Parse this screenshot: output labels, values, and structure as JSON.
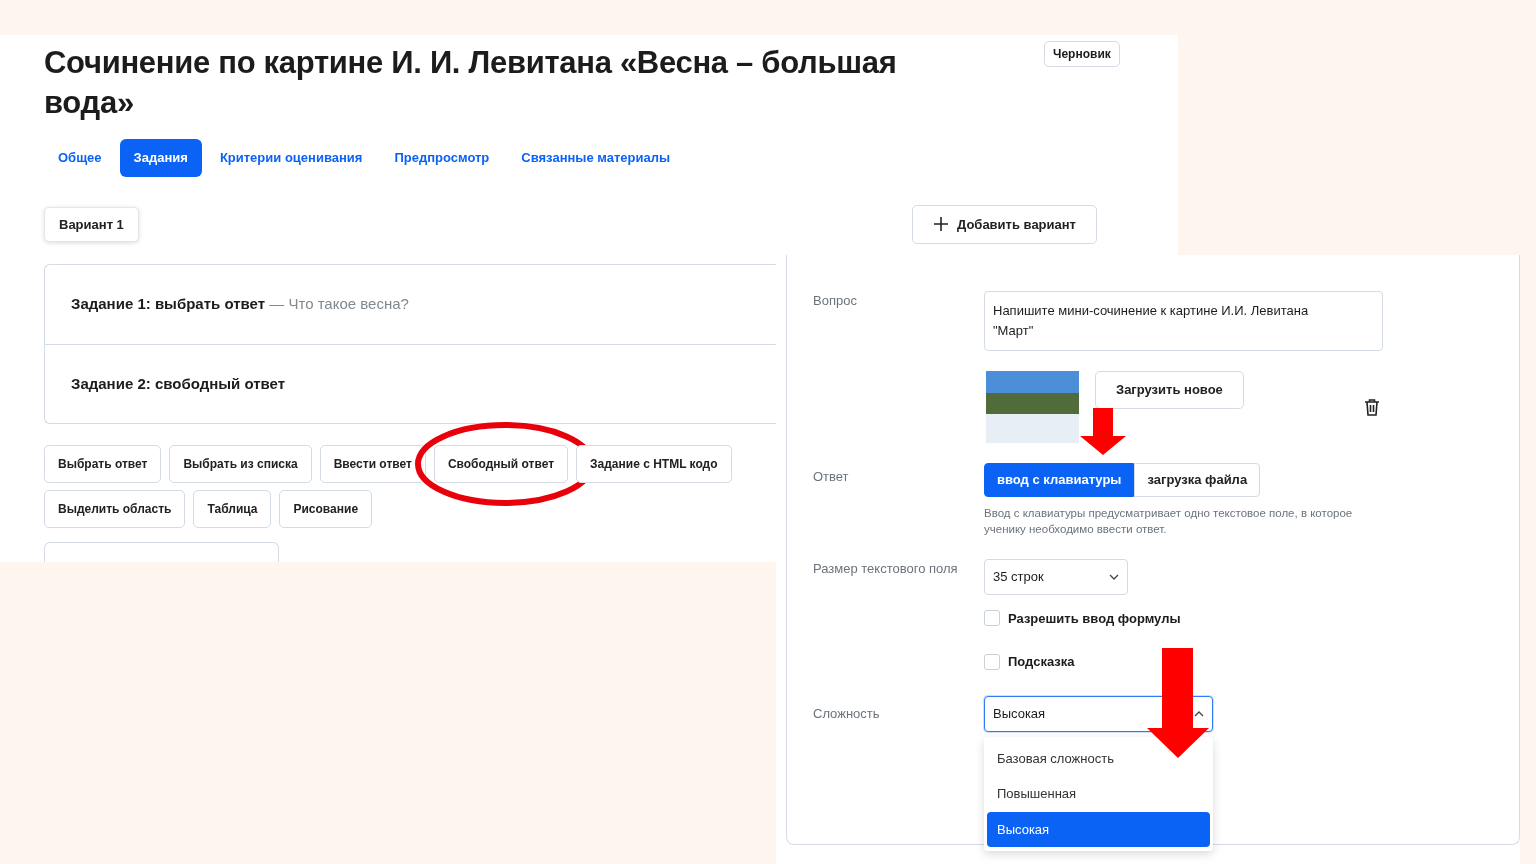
{
  "page": {
    "title": "Сочинение по картине И. И. Левитана «Весна – большая вода»",
    "status_badge": "Черновик"
  },
  "tabs": [
    {
      "label": "Общее",
      "selected": false
    },
    {
      "label": "Задания",
      "selected": true
    },
    {
      "label": "Критерии оценивания",
      "selected": false
    },
    {
      "label": "Предпросмотр",
      "selected": false
    },
    {
      "label": "Связанные материалы",
      "selected": false
    }
  ],
  "variants": [
    {
      "label": "Вариант 1"
    }
  ],
  "add_variant_button": "Добавить вариант",
  "tasks": [
    {
      "title": "Задание 1: выбрать ответ",
      "subtitle": "— Что такое весна?"
    },
    {
      "title": "Задание 2: свободный ответ"
    }
  ],
  "task_types": [
    {
      "label": "Выбрать ответ",
      "highlighted": false
    },
    {
      "label": "Выбрать из списка",
      "highlighted": false
    },
    {
      "label": "Ввести ответ",
      "highlighted": false
    },
    {
      "label": "Свободный ответ",
      "highlighted": true
    },
    {
      "label": "Задание с HTML кодо",
      "highlighted": false
    },
    {
      "label": "Выделить область",
      "highlighted": false
    },
    {
      "label": "Таблица",
      "highlighted": false
    },
    {
      "label": "Рисование",
      "highlighted": false
    }
  ],
  "editor": {
    "question_label": "Вопрос",
    "question_text": "Напишите мини-сочинение к картине И.И. Левитана \"Март\"",
    "upload_button": "Загрузить новое",
    "answer_label": "Ответ",
    "answer_modes": [
      {
        "label": "ввод с клавиатуры",
        "selected": true
      },
      {
        "label": "загрузка файла",
        "selected": false
      }
    ],
    "answer_hint": "Ввод с клавиатуры предусматривает одно текстовое поле, в которое ученику необходимо ввести ответ.",
    "size_label": "Размер текстового поля",
    "size_value": "35 строк",
    "options": [
      {
        "label": "Разрешить ввод формулы",
        "checked": false
      },
      {
        "label": "Подсказка",
        "checked": false
      }
    ],
    "difficulty_label": "Сложность",
    "difficulty_value": "Высокая",
    "difficulty_menu": {
      "expanded": true,
      "items": [
        {
          "label": "Базовая сложность",
          "selected": false
        },
        {
          "label": "Повышенная",
          "selected": false
        },
        {
          "label": "Высокая",
          "selected": true
        }
      ]
    }
  }
}
